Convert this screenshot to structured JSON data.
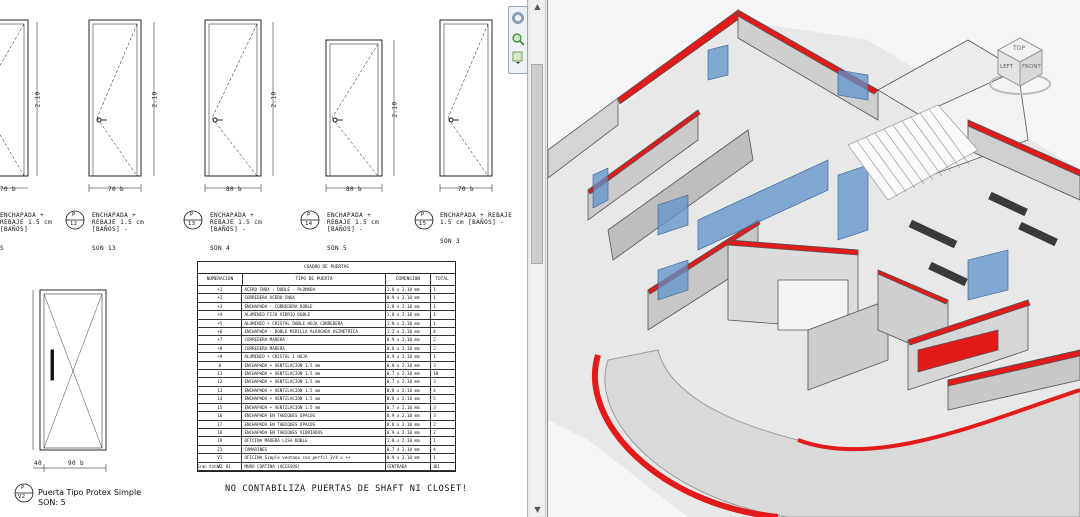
{
  "left_view": {
    "door_callouts": [
      {
        "tag_top": "",
        "tag_bottom": "",
        "desc": [
          "ENCHAPADA +",
          "REBAJE 1.5 cm",
          "[BAÑOS]"
        ],
        "son": "S",
        "width_dim": "70 b",
        "height_dim": "2.10"
      },
      {
        "tag_top": "P",
        "tag_bottom": "12",
        "desc": [
          "ENCHAPADA +",
          "REBAJE 1.5 cm",
          "[BAÑOS] -"
        ],
        "son": "SON 13",
        "width_dim": "70 b",
        "height_dim": "2.10"
      },
      {
        "tag_top": "P",
        "tag_bottom": "13",
        "desc": [
          "ENCHAPADA +",
          "REBAJE 1.5 cm",
          "[BAÑOS] -"
        ],
        "son": "SON 4",
        "width_dim": "80 b",
        "height_dim": "2.10"
      },
      {
        "tag_top": "P",
        "tag_bottom": "14",
        "desc": [
          "ENCHAPADA +",
          "REBAJE 1.5 cm",
          "[BAÑOS] -"
        ],
        "son": "SON 5",
        "width_dim": "80 b",
        "height_dim": "2.10"
      },
      {
        "tag_top": "P",
        "tag_bottom": "15",
        "desc": [
          "ENCHAPADA + REBAJE",
          "1.5 cm [BAÑOS] -"
        ],
        "son": "SON 3",
        "width_dim": "70 b",
        "height_dim": "2.10"
      }
    ],
    "glass_door": {
      "tag_top": "P",
      "tag_bottom": "V2",
      "label": "Puerta Tipo Protex Simple",
      "son": "SON: 5",
      "dims": [
        "40",
        "90 b"
      ]
    },
    "table": {
      "title": "CUADRO DE PUERTAS",
      "headers": [
        "NUMERACION",
        "TIPO DE PUERTA",
        "DIMENSION",
        "TOTAL"
      ],
      "rows": [
        [
          "+1",
          "ACERO INOX - DOBLE - PLOMADA",
          "1.8 x 2.10 mm",
          "1"
        ],
        [
          "+2",
          "CORREDERA ACERO INOX",
          "0.9 x 2.10 mm",
          "1"
        ],
        [
          "+3",
          "ENCHAPADA - CORREDERA DOBLE",
          "1.8 x 2.10 mm",
          "1"
        ],
        [
          "+4",
          "ALUMINIO FIJO VIDRIO DOBLE",
          "1.8 x 2.10 mm",
          "1"
        ],
        [
          "+5",
          "ALUMINIO + CRISTAL DOBLE HOJA CORREDERA",
          "1.8 x 2.10 mm",
          "1"
        ],
        [
          "+6",
          "ENCHAPADA - DOBLE MIRILLA ALARGADA ASIMETRICA",
          "1.2 x 2.10 mm",
          "4"
        ],
        [
          "+7",
          "CORREDERA MADERA",
          "0.9 x 2.10 mm",
          "2"
        ],
        [
          "+8",
          "CORREDERA MADERA",
          "0.8 x 2.10 mm",
          "2"
        ],
        [
          "+9",
          "ALUMINIO + CRISTAL 1 HOJA",
          "0.9 x 2.10 mm",
          "1"
        ],
        [
          "8",
          "ENCHAPADA + VENTILACION 1.5 mm",
          "0.8 x 2.10 mm",
          "3"
        ],
        [
          "11",
          "ENCHAPADA + VENTILACION 1.5 mm",
          "0.7 x 2.10 mm",
          "18"
        ],
        [
          "12",
          "ENCHAPADA + VENTILACION 1.5 mm",
          "0.7 x 2.10 mm",
          "3"
        ],
        [
          "13",
          "ENCHAPADA + VENTILACION 1.5 mm",
          "0.8 x 2.10 mm",
          "4"
        ],
        [
          "14",
          "ENCHAPADA + VENTILACION 1.5 mm",
          "0.8 x 2.10 mm",
          "5"
        ],
        [
          "15",
          "ENCHAPADA + VENTILACION 1.5 mm",
          "0.7 x 2.10 mm",
          "3"
        ],
        [
          "16",
          "ENCHAPADA EN TABIQUES OPACOS",
          "0.9 x 2.10 mm",
          "3"
        ],
        [
          "17",
          "ENCHAPADA EN TABIQUES OPACOS",
          "0.8 x 2.10 mm",
          "2"
        ],
        [
          "18",
          "ENCHAPADA EN TABIQUES VIDRIADOS",
          "0.9 x 2.10 mm",
          "2"
        ],
        [
          "19",
          "OFICINA MADERA LISA DOBLE",
          "1.8 x 2.10 mm",
          "1"
        ],
        [
          "21",
          "CAMARINES",
          "0.7 x 2.10 mm",
          "4"
        ],
        [
          "V1",
          "OFICINA_Simple ventana con perfil 3/4 x ++",
          "0.9 x 2.10 mm",
          "1"
        ],
        [
          "V2",
          "MURO CORTINA (ACCESOS)",
          "CENTRADA",
          "1"
        ]
      ],
      "footnote": "Gran total: 81",
      "footnote_total": "81"
    },
    "warning": "NO CONTABILIZA PUERTAS DE SHAFT NI CLOSET!"
  },
  "right_view": {
    "viewcube_labels": [
      "TOP",
      "LEFT",
      "FRONT"
    ],
    "wall_cut_color": "#e21a1a",
    "glass_color": "#5f93c9"
  }
}
